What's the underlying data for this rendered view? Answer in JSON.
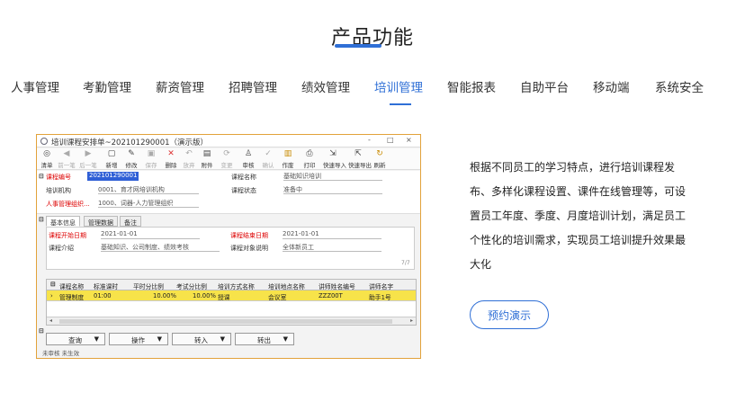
{
  "header": {
    "title": "产品功能"
  },
  "tabs": [
    {
      "label": "人事管理"
    },
    {
      "label": "考勤管理"
    },
    {
      "label": "薪资管理"
    },
    {
      "label": "招聘管理"
    },
    {
      "label": "绩效管理"
    },
    {
      "label": "培训管理",
      "active": true
    },
    {
      "label": "智能报表"
    },
    {
      "label": "自助平台"
    },
    {
      "label": "移动端"
    },
    {
      "label": "系统安全"
    }
  ],
  "screenshot": {
    "window_title": "培训课程安排单~202101290001（演示版）",
    "window_controls": [
      "-",
      "□",
      "×"
    ],
    "toolbar": [
      {
        "label": "清单",
        "icon": "list-icon"
      },
      {
        "label": "前一笔",
        "icon": "prev-icon"
      },
      {
        "label": "后一笔",
        "icon": "next-icon"
      },
      {
        "label": "新增",
        "icon": "new-icon"
      },
      {
        "label": "修改",
        "icon": "edit-icon"
      },
      {
        "label": "保存",
        "icon": "save-icon"
      },
      {
        "label": "删除",
        "icon": "delete-icon"
      },
      {
        "label": "放弃",
        "icon": "discard-icon"
      },
      {
        "label": "附件",
        "icon": "attach-icon"
      },
      {
        "label": "变更",
        "icon": "change-icon"
      },
      {
        "label": "审核",
        "icon": "audit-icon"
      },
      {
        "label": "确认",
        "icon": "confirm-icon"
      },
      {
        "label": "作废",
        "icon": "void-icon"
      },
      {
        "label": "打印",
        "icon": "print-icon"
      },
      {
        "label": "快速导入",
        "icon": "import-icon"
      },
      {
        "label": "快速导出",
        "icon": "export-icon"
      },
      {
        "label": "刷新",
        "icon": "refresh-icon"
      }
    ],
    "fields": {
      "course_no_label": "课程编号",
      "course_no_value": "202101290001",
      "course_name_label": "课程名称",
      "course_name_value": "基础知识培训",
      "org_label": "培训机构",
      "org_value": "0001、育才网培训机构",
      "status_label": "课程状态",
      "status_value": "准备中",
      "hr_label": "人事管理组织...",
      "hr_value": "1000、词器-人力管理组织"
    },
    "subtabs": [
      "基本信息",
      "管理数据",
      "备注"
    ],
    "basic": {
      "start_label": "课程开始日期",
      "start_value": "2021-01-01",
      "end_label": "课程结束日期",
      "end_value": "2021-01-01",
      "intro_label": "课程介绍",
      "intro_value": "基础知识、公司制度、绩效考核",
      "target_label": "课程对象说明",
      "target_value": "全体新员工",
      "count": "7/7"
    },
    "grid": {
      "headers": [
        "课程名称",
        "标准课时",
        "平时分比例",
        "考试分比例",
        "培训方式名称",
        "培训地点名称",
        "讲师姓名编号",
        "讲师名字"
      ],
      "row": [
        "管理制度",
        "01:00",
        "10.00%",
        "10.00%",
        "授课",
        "会议室",
        "ZZZ00T",
        "助手1号"
      ]
    },
    "buttons": [
      "查询",
      "操作",
      "转入",
      "转出"
    ],
    "status": "未审核  未生效"
  },
  "description": "根据不同员工的学习特点，进行培训课程发布、多样化课程设置、课件在线管理等，可设置员工年度、季度、月度培训计划，满足员工个性化的培训需求，实现员工培训提升效果最大化",
  "cta": {
    "label": "预约演示"
  },
  "colors": {
    "accent": "#2f6fd6",
    "highlight_row": "#f7e34a",
    "window_border": "#e2a23b"
  }
}
